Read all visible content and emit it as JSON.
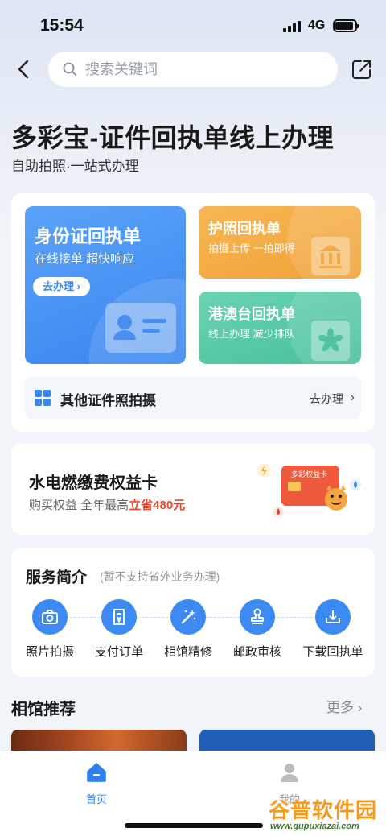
{
  "status_bar": {
    "time": "15:54",
    "network": "4G"
  },
  "search": {
    "placeholder": "搜索关键词",
    "value": ""
  },
  "header": {
    "title": "多彩宝-证件回执单线上办理",
    "subtitle": "自助拍照·一站式办理"
  },
  "tiles": {
    "id_card": {
      "title": "身份证回执单",
      "subtitle": "在线接单 超快响应",
      "action": "去办理 ›"
    },
    "passport": {
      "title": "护照回执单",
      "subtitle": "拍摄上传 一拍即得"
    },
    "hk_macau_tw": {
      "title": "港澳台回执单",
      "subtitle": "线上办理 减少排队"
    }
  },
  "other": {
    "label": "其他证件照拍摄",
    "action": "去办理"
  },
  "benefit": {
    "title": "水电燃缴费权益卡",
    "subtitle_prefix": "购买权益 全年最高",
    "subtitle_highlight": "立省480元",
    "card_text": "多彩权益卡"
  },
  "service": {
    "title": "服务简介",
    "note": "(暂不支持省外业务办理)",
    "items": [
      {
        "label": "照片拍摄",
        "icon": "camera-icon"
      },
      {
        "label": "支付订单",
        "icon": "payment-order-icon"
      },
      {
        "label": "相馆精修",
        "icon": "magic-wand-icon"
      },
      {
        "label": "邮政审核",
        "icon": "stamp-icon"
      },
      {
        "label": "下载回执单",
        "icon": "download-icon"
      }
    ]
  },
  "recommend": {
    "title": "相馆推荐",
    "more": "更多"
  },
  "tabbar": {
    "home": "首页",
    "mine": "我的"
  },
  "watermark": {
    "name": "谷普软件园",
    "url": "www.gupuxiazai.com"
  },
  "colors": {
    "primary": "#3a86ef",
    "passport": "#f2a137",
    "hk": "#46bf9c",
    "highlight": "#e8452f"
  }
}
